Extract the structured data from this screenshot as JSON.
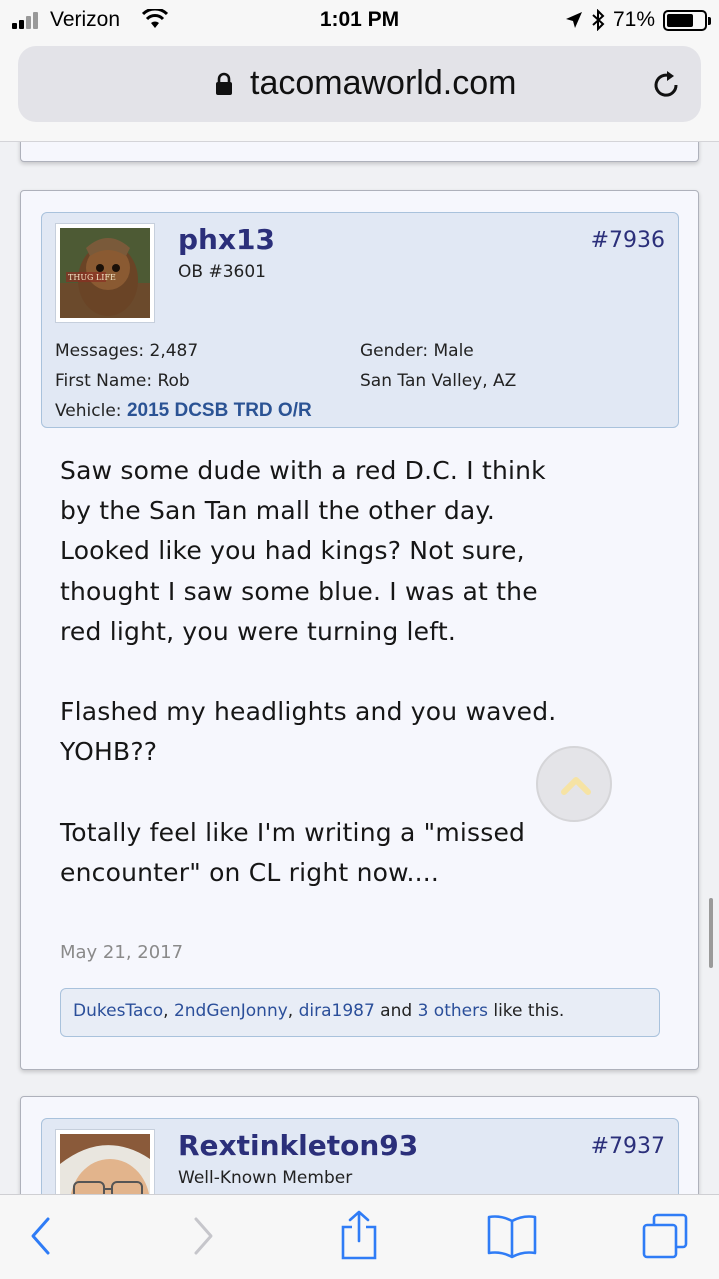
{
  "status_bar": {
    "carrier": "Verizon",
    "time": "1:01 PM",
    "battery": "71%",
    "battery_level": 0.71
  },
  "browser": {
    "url": "tacomaworld.com"
  },
  "post": {
    "username": "phx13",
    "user_title": "OB #3601",
    "avatar_caption": "THUG LIFE",
    "post_number": "#7936",
    "stats": {
      "messages_label": "Messages:",
      "messages_value": "2,487",
      "gender_label": "Gender:",
      "gender_value": "Male",
      "firstname_label": "First Name:",
      "firstname_value": "Rob",
      "location": "San Tan Valley, AZ",
      "vehicle_label": "Vehicle:",
      "vehicle_value": "2015 DCSB TRD O/R"
    },
    "message_lines": [
      "Saw some dude with a red D.C. I think",
      "by the San Tan mall the other day.",
      "Looked like you had kings? Not sure,",
      "thought I saw some blue. I was at the",
      "red light, you were turning left.",
      "",
      "Flashed my headlights and you waved.",
      "YOHB??",
      "",
      "Totally feel like I'm writing a \"missed",
      "encounter\" on CL right now...."
    ],
    "date": "May 21, 2017",
    "likes": {
      "user1": "DukesTaco",
      "sep1": ", ",
      "user2": "2ndGenJonny",
      "sep2": ", ",
      "user3": "dira1987",
      "and_text": " and ",
      "others": "3 others",
      "suffix": " like this."
    }
  },
  "next_post": {
    "username": "Rextinkleton93",
    "user_title": "Well-Known Member",
    "post_number": "#7937"
  },
  "colors": {
    "username": "#2b2f7a",
    "link": "#2b4f9a",
    "userinfo_bg": "#e1e8f4",
    "card_bg": "#f6f7fd"
  },
  "icons": [
    "signal-icon",
    "wifi-icon",
    "lock-icon",
    "reload-icon",
    "location-arrow-icon",
    "bluetooth-icon",
    "battery-icon",
    "scroll-top-icon",
    "back-icon",
    "forward-icon",
    "share-icon",
    "bookmarks-icon",
    "tabs-icon"
  ]
}
